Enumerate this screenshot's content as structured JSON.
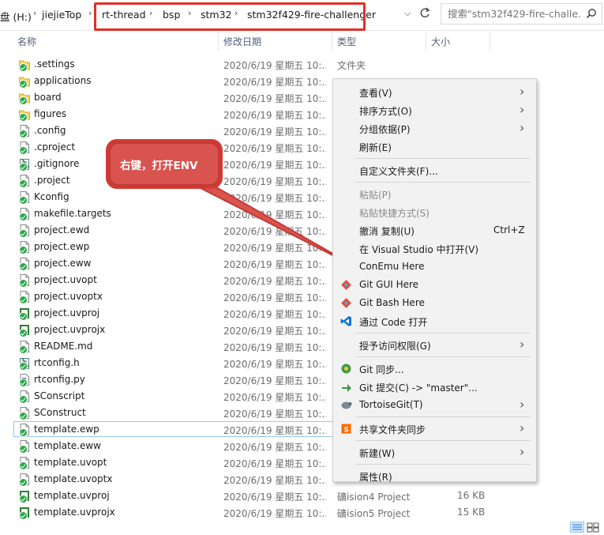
{
  "address": {
    "drive_label": "盘 (H:)",
    "parent": "jiejieTop",
    "crumbs": [
      "rt-thread",
      "bsp",
      "stm32",
      "stm32f429-fire-challenger"
    ],
    "search_placeholder": "搜索\"stm32f429-fire-challe..."
  },
  "columns": {
    "name": "名称",
    "date": "修改日期",
    "type": "类型",
    "size": "大小"
  },
  "files": [
    {
      "name": ".settings",
      "date": "2020/6/19 星期五 10:...",
      "type": "文件夹",
      "size": "",
      "icon": "folder-icon"
    },
    {
      "name": "applications",
      "date": "2020/6/19 星期五 10:...",
      "type": "",
      "size": "",
      "icon": "folder-icon"
    },
    {
      "name": "board",
      "date": "2020/6/19 星期五 10:...",
      "type": "",
      "size": "",
      "icon": "folder-icon"
    },
    {
      "name": "figures",
      "date": "2020/6/19 星期五 10:...",
      "type": "",
      "size": "",
      "icon": "folder-icon"
    },
    {
      "name": ".config",
      "date": "2020/6/19 星期五 10:...",
      "type": "",
      "size": "",
      "icon": "file-icon"
    },
    {
      "name": ".cproject",
      "date": "2020/6/19 星期五 10:...",
      "type": "",
      "size": "",
      "icon": "file-icon"
    },
    {
      "name": ".gitignore",
      "date": "2020/6/19 星期五 10:...",
      "type": "",
      "size": "",
      "icon": "notepad-icon"
    },
    {
      "name": ".project",
      "date": "2020/6/19 星期五 10:...",
      "type": "",
      "size": "",
      "icon": "file-icon"
    },
    {
      "name": "Kconfig",
      "date": "2020/6/19 星期五 10:...",
      "type": "",
      "size": "",
      "icon": "file-icon"
    },
    {
      "name": "makefile.targets",
      "date": "2020/6/19 星期五 10:...",
      "type": "",
      "size": "",
      "icon": "file-icon"
    },
    {
      "name": "project.ewd",
      "date": "2020/6/19 星期五 10:...",
      "type": "",
      "size": "",
      "icon": "file-icon"
    },
    {
      "name": "project.ewp",
      "date": "2020/6/19 星期五 10:...",
      "type": "",
      "size": "",
      "icon": "file-icon"
    },
    {
      "name": "project.eww",
      "date": "2020/6/19 星期五 10:...",
      "type": "",
      "size": "",
      "icon": "file-icon"
    },
    {
      "name": "project.uvopt",
      "date": "2020/6/19 星期五 10:...",
      "type": "",
      "size": "",
      "icon": "file-icon"
    },
    {
      "name": "project.uvoptx",
      "date": "2020/6/19 星期五 10:...",
      "type": "",
      "size": "",
      "icon": "file-icon"
    },
    {
      "name": "project.uvproj",
      "date": "2020/6/19 星期五 10:...",
      "type": "",
      "size": "",
      "icon": "keil-project-icon"
    },
    {
      "name": "project.uvprojx",
      "date": "2020/6/19 星期五 10:...",
      "type": "",
      "size": "",
      "icon": "keil-project-icon"
    },
    {
      "name": "README.md",
      "date": "2020/6/19 星期五 10:...",
      "type": "",
      "size": "",
      "icon": "file-icon"
    },
    {
      "name": "rtconfig.h",
      "date": "2020/6/19 星期五 10:...",
      "type": "",
      "size": "",
      "icon": "notepad-icon"
    },
    {
      "name": "rtconfig.py",
      "date": "2020/6/19 星期五 10:...",
      "type": "",
      "size": "",
      "icon": "python-file-icon"
    },
    {
      "name": "SConscript",
      "date": "2020/6/19 星期五 10:...",
      "type": "",
      "size": "",
      "icon": "file-icon"
    },
    {
      "name": "SConstruct",
      "date": "2020/6/19 星期五 10:...",
      "type": "",
      "size": "",
      "icon": "file-icon"
    },
    {
      "name": "template.ewp",
      "date": "2020/6/19 星期五 10:...",
      "type": "",
      "size": "",
      "icon": "file-icon",
      "selected": true
    },
    {
      "name": "template.eww",
      "date": "2020/6/19 星期五 10:...",
      "type": "",
      "size": "",
      "icon": "file-icon"
    },
    {
      "name": "template.uvopt",
      "date": "2020/6/19 星期五 10:...",
      "type": "",
      "size": "",
      "icon": "file-icon"
    },
    {
      "name": "template.uvoptx",
      "date": "2020/6/19 星期五 10:...",
      "type": "",
      "size": "",
      "icon": "file-icon"
    },
    {
      "name": "template.uvproj",
      "date": "2020/6/19 星期五 10:...",
      "type": "礦ision4 Project",
      "size": "16 KB",
      "icon": "keil-project-icon"
    },
    {
      "name": "template.uvprojx",
      "date": "2020/6/19 星期五 10:...",
      "type": "礦ision5 Project",
      "size": "15 KB",
      "icon": "keil-project-icon"
    }
  ],
  "context_menu": {
    "items": [
      {
        "label": "查看(V)",
        "arrow": true
      },
      {
        "label": "排序方式(O)",
        "arrow": true
      },
      {
        "label": "分组依据(P)",
        "arrow": true
      },
      {
        "label": "刷新(E)"
      },
      {
        "sep": true
      },
      {
        "label": "自定义文件夹(F)..."
      },
      {
        "sep": true
      },
      {
        "label": "粘贴(P)",
        "disabled": true
      },
      {
        "label": "粘贴快捷方式(S)",
        "disabled": true
      },
      {
        "label": "撤消 复制(U)",
        "shortcut": "Ctrl+Z"
      },
      {
        "label": "在 Visual Studio 中打开(V)"
      },
      {
        "label": "ConEmu Here"
      },
      {
        "label": "Git GUI Here",
        "icon": "git-icon"
      },
      {
        "label": "Git Bash Here",
        "icon": "git-icon"
      },
      {
        "label": "通过 Code 打开",
        "icon": "vscode-icon"
      },
      {
        "sep": true
      },
      {
        "label": "授予访问权限(G)",
        "arrow": true
      },
      {
        "sep": true
      },
      {
        "label": "Git 同步...",
        "icon": "tortoisegit-sync-icon"
      },
      {
        "label": "Git 提交(C) -> \"master\"...",
        "icon": "tortoisegit-commit-icon"
      },
      {
        "label": "TortoiseGit(T)",
        "arrow": true,
        "icon": "tortoisegit-icon"
      },
      {
        "sep": true
      },
      {
        "label": "共享文件夹同步",
        "arrow": true,
        "icon": "share-sync-icon"
      },
      {
        "sep": true
      },
      {
        "label": "新建(W)",
        "arrow": true
      },
      {
        "sep": true
      },
      {
        "label": "属性(R)"
      }
    ]
  },
  "callout": {
    "text": "右键，打开ENV"
  },
  "colors": {
    "highlight_red": "#e0302a",
    "callout_red": "#d9534f",
    "git_ok_green": "#2aa84a"
  }
}
